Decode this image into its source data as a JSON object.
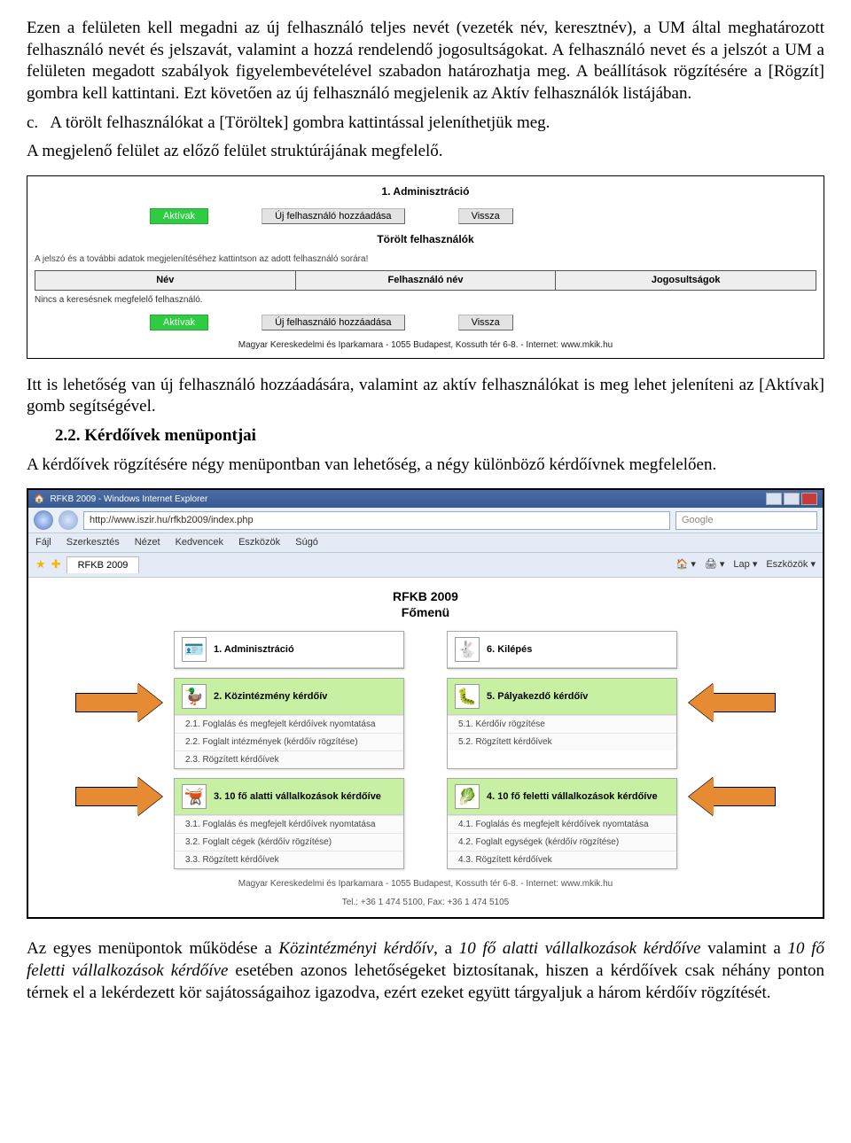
{
  "para1": "Ezen a felületen kell megadni az új felhasználó teljes nevét (vezeték név, keresztnév), a UM által meghatározott felhasználó nevét és jelszavát, valamint a hozzá rendelendő jogosultságokat. A felhasználó nevet és a jelszót a UM a felületen megadott szabályok figyelembevételével szabadon határozhatja meg. A beállítások rögzítésére a [Rögzít] gombra kell kattintani. Ezt követően az új felhasználó megjelenik az Aktív felhasználók listájában.",
  "bullet_c": "c.",
  "bullet_c_text": "A törölt felhasználókat a [Töröltek] gombra kattintással jeleníthetjük meg.",
  "para_c2": "A megjelenő felület az előző felület struktúrájának megfelelő.",
  "s1": {
    "title": "1. Adminisztráció",
    "btn_active": "Aktívak",
    "btn_add": "Új felhasználó hozzáadása",
    "btn_back": "Vissza",
    "subtitle": "Törölt felhasználók",
    "hint": "A jelszó és a további adatok megjelenítéséhez kattintson az adott felhasználó sorára!",
    "col_name": "Név",
    "col_user": "Felhasználó név",
    "col_perm": "Jogosultságok",
    "noresult": "Nincs a keresésnek megfelelő felhasználó.",
    "footer": "Magyar Kereskedelmi és Iparkamara - 1055 Budapest, Kossuth tér 6-8. - Internet: www.mkik.hu"
  },
  "para2": "Itt is lehetőség van új felhasználó hozzáadására, valamint az aktív felhasználókat is meg lehet jeleníteni az [Aktívak] gomb segítségével.",
  "heading22": "2.2. Kérdőívek menüpontjai",
  "para3": "A kérdőívek rögzítésére négy menüpontban van lehetőség, a négy különböző kérdőívnek megfelelően.",
  "ie": {
    "title": "RFKB 2009 - Windows Internet Explorer",
    "url": "http://www.iszir.hu/rfkb2009/index.php",
    "search": "Google",
    "menu": [
      "Fájl",
      "Szerkesztés",
      "Nézet",
      "Kedvencek",
      "Eszközök",
      "Súgó"
    ],
    "tab": "RFKB 2009",
    "toolbtns": [
      "Lap ▾",
      "Eszközök ▾"
    ],
    "pageTitle": "RFKB 2009",
    "pageSubtitle": "Főmenü",
    "cards": [
      {
        "head": "1. Adminisztráció",
        "green": false,
        "icon": "🪪",
        "subs": []
      },
      {
        "head": "6. Kilépés",
        "green": false,
        "icon": "🐇",
        "subs": []
      },
      {
        "head": "2. Közintézmény kérdőív",
        "green": true,
        "icon": "🦆",
        "subs": [
          "2.1. Foglalás és megfejelt kérdőívek nyomtatása",
          "2.2. Foglalt intézmények (kérdőív rögzítése)",
          "2.3. Rögzített kérdőívek"
        ]
      },
      {
        "head": "5. Pályakezdő kérdőív",
        "green": true,
        "icon": "🐛",
        "subs": [
          "5.1. Kérdőív rögzítése",
          "5.2. Rögzített kérdőívek"
        ]
      },
      {
        "head": "3. 10 fő alatti vállalkozások kérdőíve",
        "green": true,
        "icon": "🫕",
        "subs": [
          "3.1. Foglalás és megfejelt kérdőívek nyomtatása",
          "3.2. Foglalt cégek (kérdőív rögzítése)",
          "3.3. Rögzített kérdőívek"
        ]
      },
      {
        "head": "4. 10 fő feletti vállalkozások kérdőíve",
        "green": true,
        "icon": "🥬",
        "subs": [
          "4.1. Foglalás és megfejelt kérdőívek nyomtatása",
          "4.2. Foglalt egységek (kérdőív rögzítése)",
          "4.3. Rögzített kérdőívek"
        ]
      }
    ],
    "pageFooter1": "Magyar Kereskedelmi és Iparkamara - 1055 Budapest, Kossuth tér 6-8. - Internet: www.mkik.hu",
    "pageFooter2": "Tel.: +36 1 474 5100, Fax: +36 1 474 5105"
  },
  "para4a": "Az egyes menüpontok működése a ",
  "para4b": "Közintézményi kérdőív",
  "para4c": ", a ",
  "para4d": "10 fő alatti vállalkozások kérdőíve",
  "para4e": " valamint a ",
  "para4f": "10 fő feletti vállalkozások kérdőíve",
  "para4g": " esetében azonos lehetőségeket biztosítanak, hiszen a kérdőívek csak néhány ponton térnek el a lekérdezett kör sajátosságaihoz igazodva, ezért ezeket együtt tárgyaljuk a három kérdőív rögzítését."
}
